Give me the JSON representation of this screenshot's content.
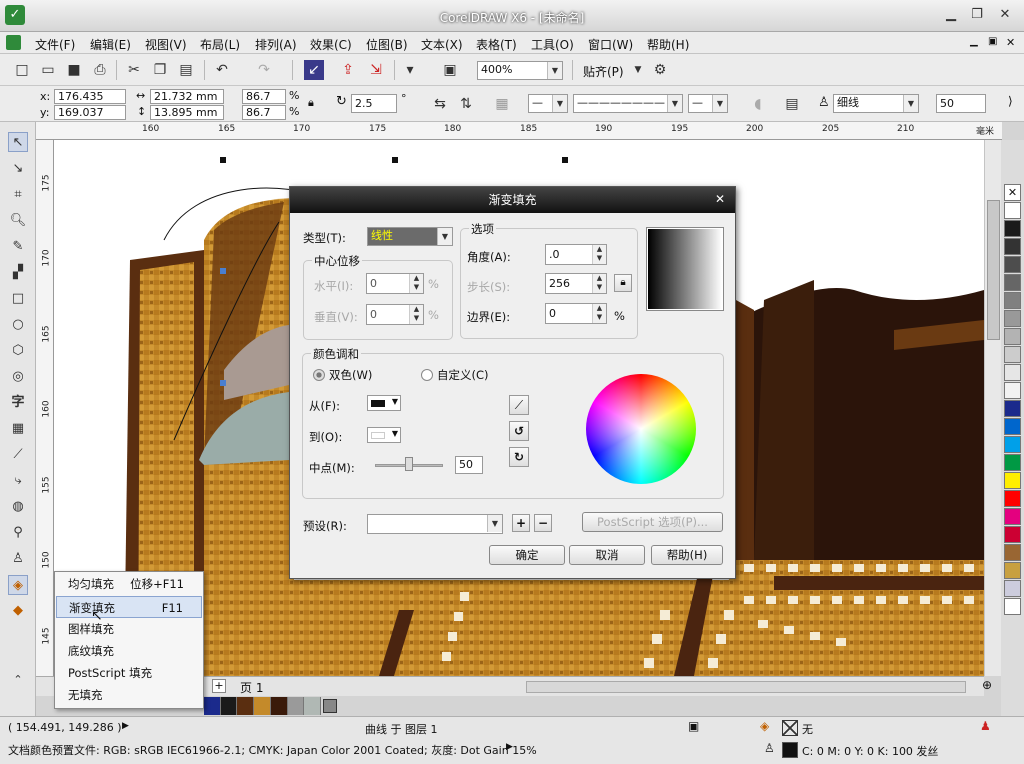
{
  "window": {
    "title": "CorelDRAW X6 - [未命名]",
    "min": "▁",
    "restore": "❐",
    "close": "✕"
  },
  "menus": [
    "文件(F)",
    "编辑(E)",
    "视图(V)",
    "布局(L)",
    "排列(A)",
    "效果(C)",
    "位图(B)",
    "文本(X)",
    "表格(T)",
    "工具(O)",
    "窗口(W)",
    "帮助(H)"
  ],
  "toolbar": {
    "zoom": "400%",
    "snap": "贴齐(P)"
  },
  "property_bar": {
    "x": "176.435 mm",
    "y": "169.037 mm",
    "w": "21.732 mm",
    "h": "13.895 mm",
    "scale_x": "86.7",
    "scale_y": "86.7",
    "pct": "%",
    "angle": "2.5",
    "deg": "°",
    "outline": "细线",
    "outline_pct": "50",
    "x_label": "x:",
    "y_label": "y:"
  },
  "ruler": {
    "h": [
      "160",
      "165",
      "170",
      "175",
      "180",
      "185",
      "190",
      "195",
      "200",
      "205",
      "210"
    ],
    "unit": "毫米",
    "v": [
      "175",
      "170",
      "165",
      "160",
      "155",
      "150",
      "145"
    ]
  },
  "dialog": {
    "title": "渐变填充",
    "type_label": "类型(T):",
    "type_value": "线性",
    "center_group": "中心位移",
    "h_label": "水平(I):",
    "h_value": "0",
    "v_label": "垂直(V):",
    "v_value": "0",
    "pct": "%",
    "options_group": "选项",
    "angle_label": "角度(A):",
    "angle_value": ".0",
    "steps_label": "步长(S):",
    "steps_value": "256",
    "edge_label": "边界(E):",
    "edge_value": "0",
    "edge_pct": "%",
    "blend_group": "颜色调和",
    "two_color": "双色(W)",
    "custom": "自定义(C)",
    "from_label": "从(F):",
    "to_label": "到(O):",
    "mid_label": "中点(M):",
    "mid_value": "50",
    "preset_label": "预设(R):",
    "postscript": "PostScript 选项(P)...",
    "ok": "确定",
    "cancel": "取消",
    "help": "帮助(H)"
  },
  "popup": [
    {
      "label": "均匀填充",
      "shortcut": "位移+F11"
    },
    {
      "label": "渐变填充",
      "shortcut": "F11"
    },
    {
      "label": "图样填充",
      "shortcut": ""
    },
    {
      "label": "底纹填充",
      "shortcut": ""
    },
    {
      "label": "PostScript 填充",
      "shortcut": ""
    },
    {
      "label": "无填充",
      "shortcut": ""
    }
  ],
  "pagebar": {
    "page": "页 1"
  },
  "status": {
    "coords": "( 154.491, 149.286 )",
    "arrow": "▶",
    "layer": "曲线 于 图层 1",
    "fill": "无",
    "outline": "C: 0 M: 0 Y: 0 K: 100  发丝",
    "profile": "文档颜色预置文件: RGB: sRGB IEC61966-2.1; CMYK: Japan Color 2001 Coated; 灰度: Dot Gain 15%"
  },
  "palette_colors": [
    "#ffffff",
    "#1a1a1a",
    "#333333",
    "#4d4d4d",
    "#666666",
    "#808080",
    "#999999",
    "#b3b3b3",
    "#cccccc",
    "#e6e6e6",
    "#f2f2f2",
    "#1b2a8c",
    "#0066cc",
    "#00a0e9",
    "#009944",
    "#ffee00",
    "#ff0000",
    "#e4007f",
    "#cc0033",
    "#996633",
    "#c8a040",
    "#ccccdd",
    "#ffffff"
  ]
}
